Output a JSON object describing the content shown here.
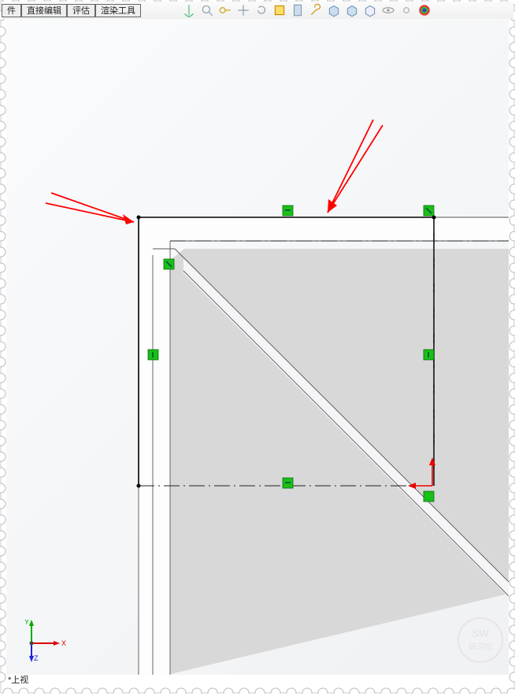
{
  "tabs": {
    "t1": "件",
    "t2": "直接编辑",
    "t3": "评估",
    "t4": "渲染工具"
  },
  "axes": {
    "x": "X",
    "y": "Y",
    "z": "Z"
  },
  "status": {
    "view": "*上视"
  },
  "watermark": {
    "line1": "SW",
    "line2": "研习社"
  },
  "icons": {
    "target": "target-icon",
    "key": "key-icon",
    "tool1": "tool-icon",
    "tool2": "tool-icon",
    "wrench": "wrench-icon",
    "doc": "document-icon",
    "hammer": "hammer-icon",
    "box1": "box-icon",
    "box2": "box-icon",
    "box3": "box-icon",
    "eye": "eye-icon",
    "gear": "gear-icon",
    "globe": "globe-icon"
  }
}
